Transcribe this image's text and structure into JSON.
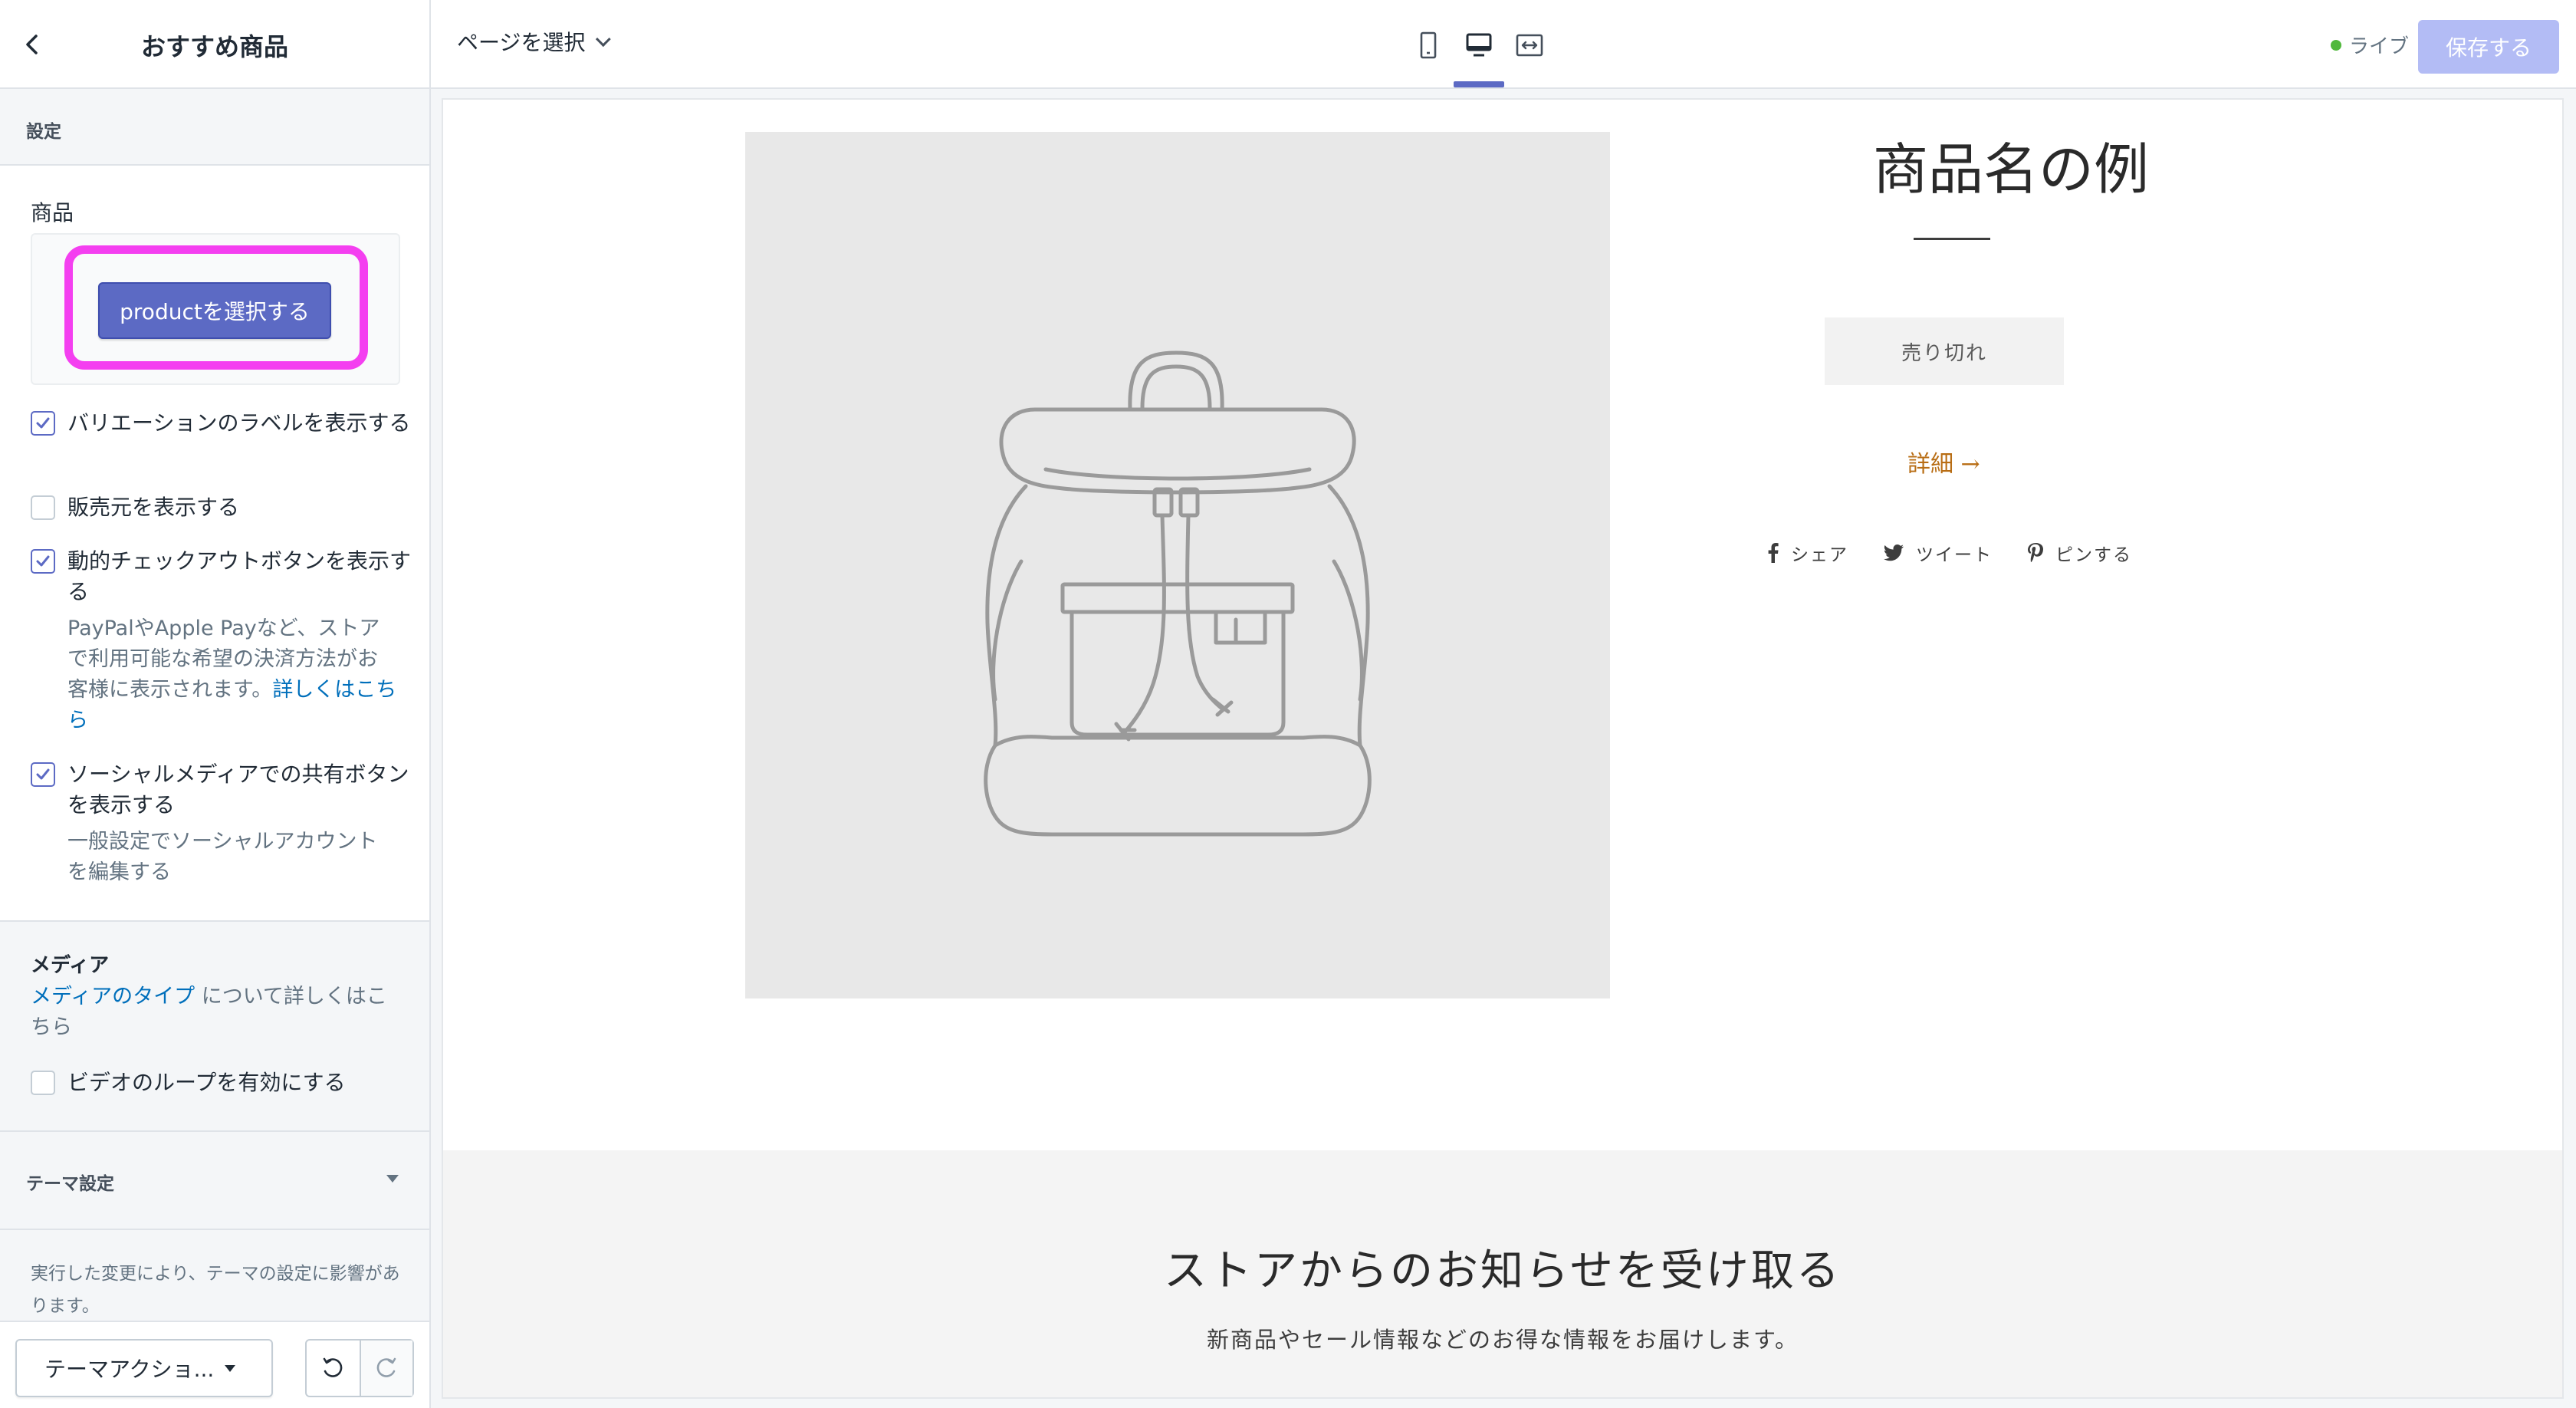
{
  "sidebar": {
    "title": "おすすめ商品",
    "settings_label": "設定",
    "product_label": "商品",
    "select_product_button": "productを選択する",
    "checkboxes": [
      {
        "label": "バリエーションのラベルを表示する",
        "checked": true
      },
      {
        "label": "販売元を表示する",
        "checked": false
      },
      {
        "label": "動的チェックアウトボタンを表示する",
        "checked": true
      },
      {
        "label": "ソーシャルメディアでの共有ボタンを表示する",
        "checked": true
      },
      {
        "label": "ビデオのループを有効にする",
        "checked": false
      }
    ],
    "dynamic_checkout_help": "PayPalやApple Payなど、ストアで利用可能な希望の決済方法がお客様に表示されます。",
    "dynamic_checkout_help_link": "詳しくはこちら",
    "social_help": "一般設定でソーシャルアカウントを編集する",
    "media_title": "メディア",
    "media_link": "メディアのタイプ",
    "media_help_suffix": " について詳しくはこちら",
    "theme_settings_label": "テーマ設定",
    "theme_note": "実行した変更により、テーマの設定に影響があります。",
    "theme_actions_button": "テーマアクショ...",
    "highlight_color": "#f43ff0"
  },
  "topbar": {
    "page_select": "ページを選択",
    "devices": [
      "mobile-icon",
      "desktop-icon",
      "fullwidth-icon"
    ],
    "active_device": "desktop",
    "status": "ライブ",
    "save_button": "保存する"
  },
  "preview": {
    "product_title": "商品名の例",
    "sold_out_button": "売り切れ",
    "details_link": "詳細 →",
    "share": {
      "facebook": "シェア",
      "twitter": "ツイート",
      "pinterest": "ピンする"
    },
    "newsletter_title": "ストアからのお知らせを受け取る",
    "newsletter_subtitle": "新商品やセール情報などのお得な情報をお届けします。"
  }
}
